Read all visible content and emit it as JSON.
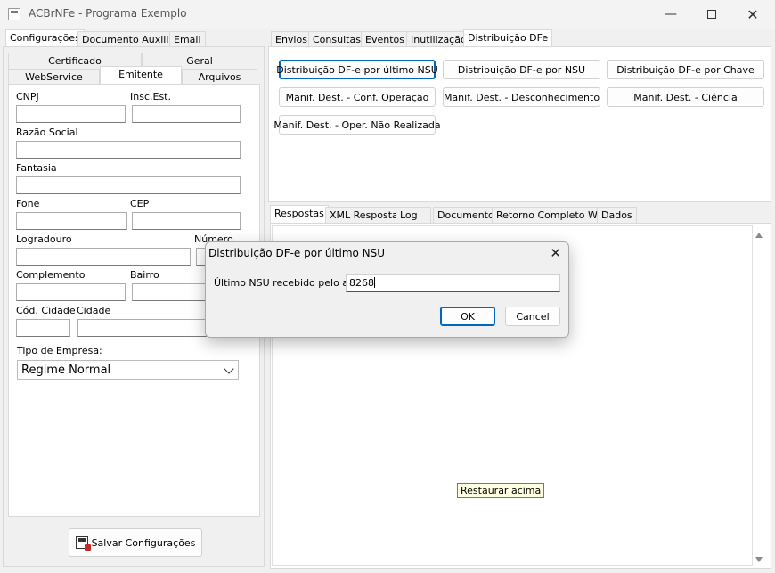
{
  "window": {
    "title": "ACBrNFe - Programa Exemplo"
  },
  "left_tabs": [
    "Configurações",
    "Documento Auxiliar",
    "Email"
  ],
  "sub_tabs_row1": [
    "Certificado",
    "Geral"
  ],
  "sub_tabs_row2": [
    "WebService",
    "Emitente",
    "Arquivos"
  ],
  "form": {
    "cnpj": "CNPJ",
    "insc_est": "Insc.Est.",
    "razao_social": "Razão Social",
    "fantasia": "Fantasia",
    "fone": "Fone",
    "cep": "CEP",
    "logradouro": "Logradouro",
    "numero": "Número",
    "complemento": "Complemento",
    "bairro": "Bairro",
    "cod_cidade": "Cód. Cidade",
    "cidade": "Cidade",
    "tipo_empresa": "Tipo de Empresa:",
    "tipo_empresa_value": "Regime Normal"
  },
  "save_button": "Salvar Configurações",
  "right_tabs": [
    "Envios",
    "Consultas",
    "Eventos",
    "Inutilização",
    "Distribuição DFe"
  ],
  "dfe_buttons": [
    "Distribuição DF-e por último NSU",
    "Distribuição DF-e por NSU",
    "Distribuição DF-e por Chave",
    "Manif. Dest. - Conf. Operação",
    "Manif. Dest. - Desconhecimento",
    "Manif. Dest. - Ciência",
    "Manif. Dest. - Oper. Não Realizada"
  ],
  "result_tabs": [
    "Respostas",
    "XML Resposta",
    "Log",
    "Documento",
    "Retorno Completo WS",
    "Dados"
  ],
  "dialog": {
    "title": "Distribuição DF-e por último NSU",
    "label": "Último NSU recebido pelo ator",
    "value": "8268",
    "ok": "OK",
    "cancel": "Cancel"
  },
  "tooltip": "Restaurar acima"
}
